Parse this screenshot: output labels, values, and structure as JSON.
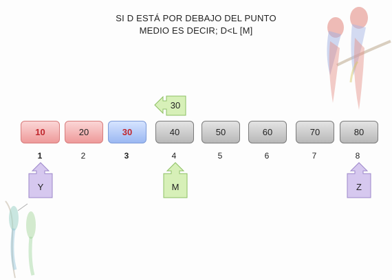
{
  "title_lines": [
    "SI D ESTÁ POR DEBAJO DEL PUNTO",
    "MEDIO ES DECIR; D<L [M]"
  ],
  "cells": [
    {
      "value": "10",
      "style": "red",
      "text_color": "#c0272d"
    },
    {
      "value": "20",
      "style": "red",
      "text_color": "#222222"
    },
    {
      "value": "30",
      "style": "blue",
      "text_color": "#c0272d"
    },
    {
      "value": "40",
      "style": "gray",
      "text_color": "#222222"
    },
    {
      "value": "50",
      "style": "gray",
      "text_color": "#222222"
    },
    {
      "value": "60",
      "style": "gray",
      "text_color": "#222222"
    },
    {
      "value": "70",
      "style": "gray",
      "text_color": "#222222"
    },
    {
      "value": "80",
      "style": "gray",
      "text_color": "#222222"
    }
  ],
  "indices": [
    "1",
    "2",
    "3",
    "4",
    "5",
    "6",
    "7",
    "8"
  ],
  "pointers": {
    "target": {
      "label": "30",
      "color": "#d7f0b8"
    },
    "low": {
      "label": "Y",
      "color": "#d6c8ef"
    },
    "mid": {
      "label": "M",
      "color": "#d7f0b8"
    },
    "high": {
      "label": "Z",
      "color": "#d6c8ef"
    }
  },
  "decorations": [
    "parrots-image",
    "hummingbirds-image"
  ]
}
